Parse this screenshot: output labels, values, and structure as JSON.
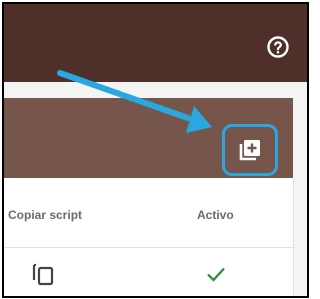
{
  "header": {
    "help_icon": "help-circle-icon"
  },
  "banner": {
    "add_button_icon": "library-add-icon"
  },
  "table": {
    "columns": [
      "Copiar script",
      "Activo"
    ],
    "rows": [
      {
        "copy_icon": "copy-icon",
        "active_icon": "check-icon"
      }
    ]
  },
  "annotation": {
    "arrow_color": "#29a8e0",
    "highlight_color": "#29a8e0"
  },
  "colors": {
    "topbar": "#4e2f29",
    "banner": "#76554b",
    "check": "#2e8b2e"
  }
}
